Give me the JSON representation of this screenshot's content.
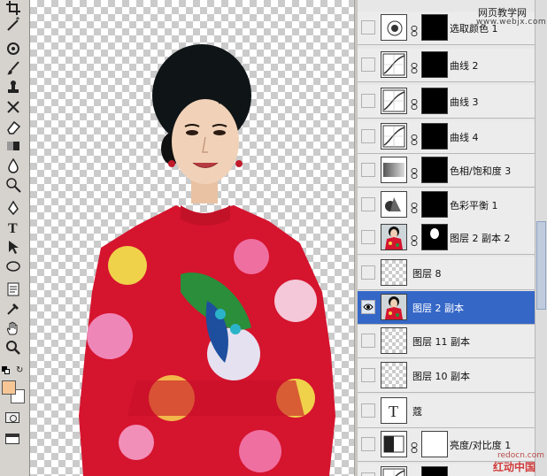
{
  "toolbox": {
    "tools": [
      {
        "name": "crop-tool-icon"
      },
      {
        "name": "magic-wand-icon"
      },
      {
        "name": "healing-brush-icon"
      },
      {
        "name": "brush-icon"
      },
      {
        "name": "clone-stamp-icon"
      },
      {
        "name": "history-brush-icon"
      },
      {
        "name": "eraser-icon"
      },
      {
        "name": "gradient-icon"
      },
      {
        "name": "blur-icon"
      },
      {
        "name": "dodge-icon"
      },
      {
        "name": "pen-icon"
      },
      {
        "name": "type-icon"
      },
      {
        "name": "path-selection-icon"
      },
      {
        "name": "ellipse-shape-icon"
      },
      {
        "name": "notes-icon"
      },
      {
        "name": "eyedropper-icon"
      },
      {
        "name": "hand-icon"
      },
      {
        "name": "zoom-icon"
      }
    ],
    "type_glyph": "T",
    "foreground_color": "#f6c795",
    "background_color": "#ffffff"
  },
  "layers": [
    {
      "name": "选取颜色 1",
      "type": "adjustment",
      "icon": "selective-color-icon",
      "visible": false
    },
    {
      "name": "曲线 2",
      "type": "adjustment",
      "icon": "curves-icon",
      "visible": false
    },
    {
      "name": "曲线 3",
      "type": "adjustment",
      "icon": "curves-icon",
      "visible": false
    },
    {
      "name": "曲线 4",
      "type": "adjustment",
      "icon": "curves-icon",
      "visible": false
    },
    {
      "name": "色相/饱和度 3",
      "type": "adjustment",
      "icon": "hue-saturation-icon",
      "visible": false
    },
    {
      "name": "色彩平衡 1",
      "type": "adjustment",
      "icon": "color-balance-icon",
      "visible": false
    },
    {
      "name": "图层 2 副本 2",
      "type": "photo-masked",
      "icon": "photo-thumbnail",
      "visible": false
    },
    {
      "name": "图层 8",
      "type": "empty",
      "icon": "transparent-thumbnail",
      "visible": false
    },
    {
      "name": "图层 2 副本",
      "type": "photo",
      "icon": "photo-thumbnail",
      "visible": true,
      "selected": true
    },
    {
      "name": "图层 11 副本",
      "type": "empty",
      "icon": "transparent-thumbnail",
      "visible": false
    },
    {
      "name": "图层 10 副本",
      "type": "empty",
      "icon": "transparent-thumbnail",
      "visible": false
    },
    {
      "name": "蔻",
      "type": "text",
      "icon": "text-layer-icon",
      "visible": false
    },
    {
      "name": "亮度/对比度 1",
      "type": "adjustment",
      "icon": "brightness-contrast-icon",
      "visible": false
    },
    {
      "name": "",
      "type": "adjustment",
      "icon": "curves-icon",
      "visible": false
    }
  ],
  "watermark": {
    "top": "网页教学网",
    "url": "www.webjx.com",
    "bottom_url": "redocn.com",
    "bottom": "红动中国"
  },
  "colors": {
    "selection": "#3567c7",
    "panel": "#ececec",
    "qipao_red": "#d5142e"
  }
}
